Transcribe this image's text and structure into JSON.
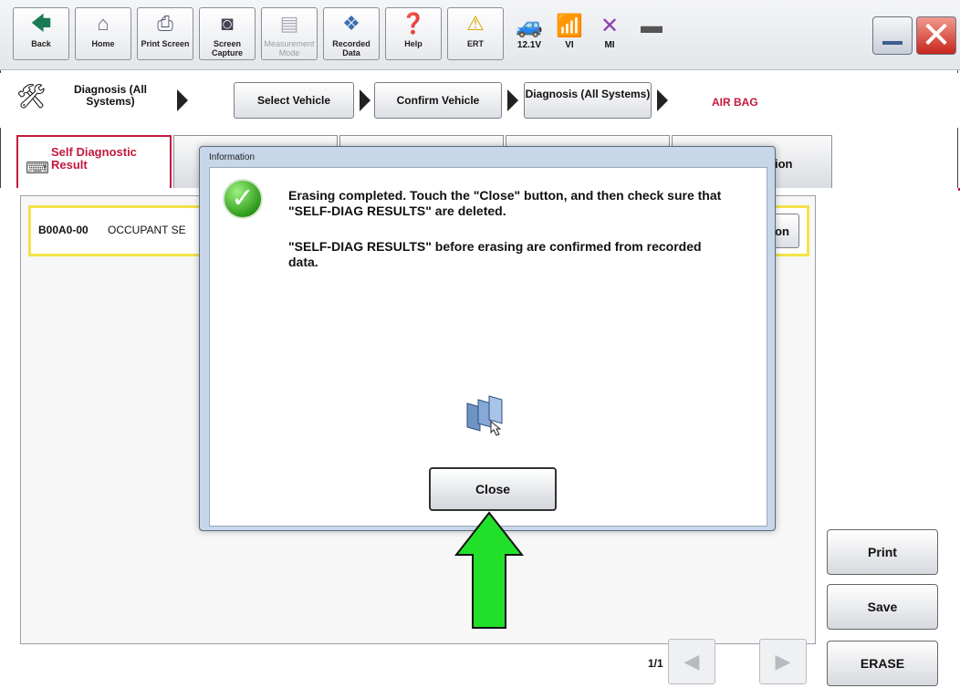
{
  "toolbar": {
    "buttons": [
      {
        "label": "Back",
        "icon": "back-arrow-icon"
      },
      {
        "label": "Home",
        "icon": "home-icon"
      },
      {
        "label": "Print Screen",
        "icon": "printer-icon"
      },
      {
        "label": "Screen Capture",
        "icon": "camera-icon"
      },
      {
        "label": "Measurement Mode",
        "icon": "meter-icon"
      },
      {
        "label": "Recorded Data",
        "icon": "recorded-data-icon"
      },
      {
        "label": "Help",
        "icon": "help-icon"
      },
      {
        "label": "ERT",
        "icon": "warning-icon"
      }
    ],
    "status": [
      {
        "label": "12.1V",
        "icon": "car-battery-icon"
      },
      {
        "label": "VI",
        "icon": "signal-icon"
      },
      {
        "label": "MI",
        "icon": "x-mark-icon"
      }
    ]
  },
  "breadcrumb": {
    "first": "Diagnosis (All Systems)",
    "steps": [
      "Select Vehicle",
      "Confirm Vehicle",
      "Diagnosis (All Systems)"
    ],
    "current": "AIR BAG"
  },
  "tabs": {
    "active": "Self Diagnostic Result",
    "partial": "ion"
  },
  "dtc": {
    "code": "B00A0-00",
    "text": "OCCUPANT SE",
    "button_label": "ion"
  },
  "dialog": {
    "title": "Information",
    "message1": "Erasing completed. Touch the \"Close\" button, and then check sure that \"SELF-DIAG RESULTS\" are deleted.",
    "message2": "\"SELF-DIAG RESULTS\" before erasing are confirmed from recorded data.",
    "close_label": "Close"
  },
  "pagination": {
    "indicator": "1/1"
  },
  "side_buttons": {
    "print": "Print",
    "save": "Save",
    "erase": "ERASE"
  },
  "colors": {
    "accent": "#c4183c",
    "arrow": "#22e02a",
    "check": "#2e9b1c"
  }
}
